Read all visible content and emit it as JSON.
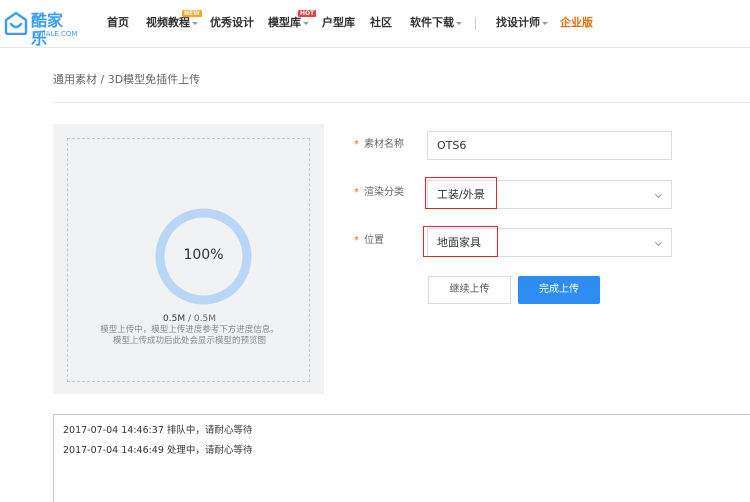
{
  "header": {
    "logo_cn": "酷家乐",
    "logo_en": "KUJIALE.COM",
    "nav": [
      {
        "label": "首页"
      },
      {
        "label": "视频教程",
        "badge": "NEW"
      },
      {
        "label": "优秀设计"
      },
      {
        "label": "模型库",
        "badge": "HOT"
      },
      {
        "label": "户型库"
      },
      {
        "label": "社区"
      },
      {
        "label": "软件下载"
      },
      {
        "label": "找设计师"
      },
      {
        "label": "企业版"
      }
    ]
  },
  "breadcrumb": "通用素材 / 3D模型免插件上传",
  "upload": {
    "progress_text": "100%",
    "progress": 1.0,
    "size_done": "0.5M",
    "size_sep": " / ",
    "size_total": "0.5M",
    "info_1": "模型上传中，模型上传进度参考下方进度信息。",
    "info_2": "模型上传成功后此处会显示模型的预览图"
  },
  "form": {
    "name_label": "素材名称",
    "name_value": "OTS6",
    "category_label": "渲染分类",
    "category_value": "工装/外景",
    "position_label": "位置",
    "position_value": "地面家具",
    "continue_label": "继续上传",
    "finish_label": "完成上传"
  },
  "log": [
    "2017-07-04 14:46:37 排队中，请耐心等待",
    "2017-07-04 14:46:49 处理中，请耐心等待"
  ],
  "colors": {
    "accent": "#2e8df3",
    "brand": "#3a9df6",
    "enterprise": "#f06c0f",
    "ring": "#b9d6f7",
    "highlight": "#e0262b"
  }
}
